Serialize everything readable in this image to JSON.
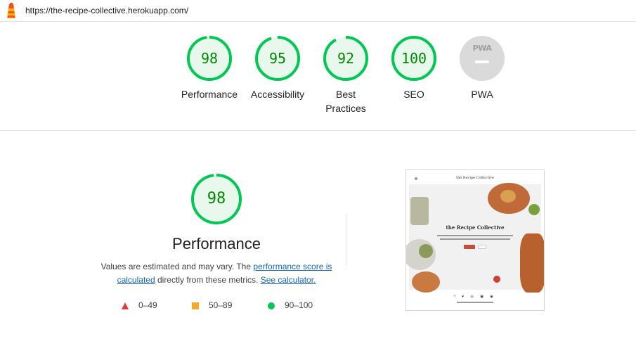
{
  "browser": {
    "url": "https://the-recipe-collective.herokuapp.com/",
    "logo_icon": "lighthouse-icon"
  },
  "categories": [
    {
      "label": "Performance",
      "score": "98",
      "color": "#00c853"
    },
    {
      "label": "Accessibility",
      "score": "95",
      "color": "#00c853"
    },
    {
      "label": "Best Practices",
      "score": "92",
      "color": "#00c853"
    },
    {
      "label": "SEO",
      "score": "100",
      "color": "#00c853"
    },
    {
      "label": "PWA",
      "score": null,
      "badge": "PWA",
      "color": "#d9d9d9"
    }
  ],
  "performance": {
    "score": "98",
    "title": "Performance",
    "desc_prefix": "Values are estimated and may vary. The ",
    "link_score": "performance score is calculated",
    "desc_middle": " directly from these metrics. ",
    "link_calc": "See calculator."
  },
  "legend": [
    {
      "range": "0–49",
      "shape": "triangle",
      "color": "#e53935"
    },
    {
      "range": "50–89",
      "shape": "square",
      "color": "#f9a825"
    },
    {
      "range": "90–100",
      "shape": "circle",
      "color": "#00c853"
    }
  ],
  "screenshot": {
    "brand": "the Recipe Collective",
    "hero_title": "the Recipe Collective",
    "social_icons": "f ♥ ◎ ▣ ◉"
  }
}
